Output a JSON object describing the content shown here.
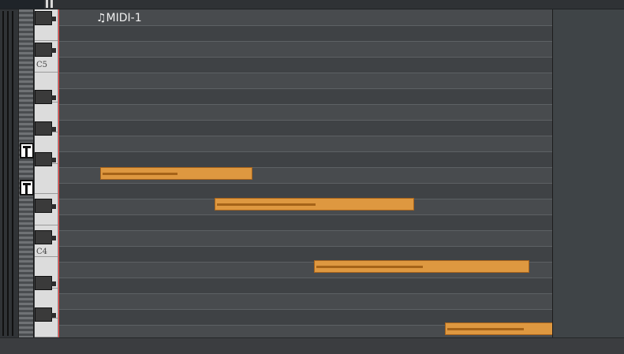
{
  "region": {
    "title": "♫MIDI-1"
  },
  "piano": {
    "labels": [
      "C5",
      "C4"
    ]
  },
  "notes": [
    {
      "row": 10
    },
    {
      "row": 12
    },
    {
      "row": 16
    },
    {
      "row": 20
    }
  ],
  "colors": {
    "note_fill": "#de9840",
    "note_border": "#a7641c",
    "velocity_bar": "#a56318",
    "playhead": "#ff4040",
    "roll_bg": "#45484b"
  }
}
